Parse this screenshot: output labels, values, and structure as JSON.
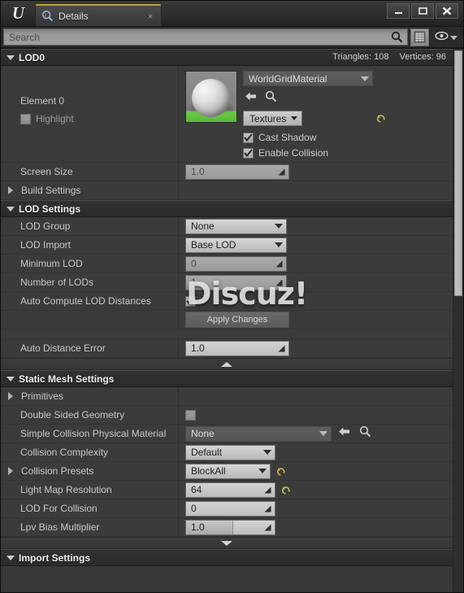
{
  "window": {
    "app_icon": "unreal-logo-icon",
    "controls": {
      "minimize": "minimize-icon",
      "maximize": "maximize-icon",
      "close": "close-icon"
    }
  },
  "tab": {
    "title": "Details",
    "icon": "details-magnifier-icon",
    "close": "×"
  },
  "search": {
    "placeholder": "Search",
    "value": "",
    "search_icon": "search-icon",
    "grid_icon": "grid-view-icon",
    "eye_icon": "eye-icon"
  },
  "watermark": "Discuz!",
  "categories": {
    "lod0": {
      "title": "LOD0",
      "triangles_label": "Triangles: 108",
      "vertices_label": "Vertices: 96"
    },
    "lod_settings": {
      "title": "LOD Settings"
    },
    "static_mesh_settings": {
      "title": "Static Mesh Settings"
    },
    "import_settings": {
      "title": "Import Settings"
    }
  },
  "lod0": {
    "element_label": "Element 0",
    "highlight_label": "Highlight",
    "material_name": "WorldGridMaterial",
    "textures_button": "Textures",
    "cast_shadow": {
      "label": "Cast Shadow",
      "checked": true
    },
    "enable_collision": {
      "label": "Enable Collision",
      "checked": true
    },
    "screen_size": {
      "label": "Screen Size",
      "value": "1.0"
    },
    "build_settings": {
      "label": "Build Settings"
    }
  },
  "lod_settings": {
    "lod_group": {
      "label": "LOD Group",
      "value": "None"
    },
    "lod_import": {
      "label": "LOD Import",
      "value": "Base LOD"
    },
    "minimum_lod": {
      "label": "Minimum LOD",
      "value": "0"
    },
    "number_of_lods": {
      "label": "Number of LODs",
      "value": "1"
    },
    "auto_compute": {
      "label": "Auto Compute LOD Distances",
      "checked": true
    },
    "apply_changes": {
      "label": "Apply Changes"
    },
    "auto_distance_error": {
      "label": "Auto Distance Error",
      "value": "1.0"
    }
  },
  "static_mesh_settings": {
    "primitives": {
      "label": "Primitives"
    },
    "double_sided": {
      "label": "Double Sided Geometry",
      "checked": false
    },
    "simple_collision_material": {
      "label": "Simple Collision Physical Material",
      "value": "None"
    },
    "collision_complexity": {
      "label": "Collision Complexity",
      "value": "Default"
    },
    "collision_presets": {
      "label": "Collision Presets",
      "value": "BlockAll"
    },
    "light_map_resolution": {
      "label": "Light Map Resolution",
      "value": "64"
    },
    "lod_for_collision": {
      "label": "LOD For Collision",
      "value": "0"
    },
    "lpv_bias_multiplier": {
      "label": "Lpv Bias Multiplier",
      "value": "1.0"
    }
  },
  "colors": {
    "panel_bg": "#383838",
    "row_bg": "#3b3b3b",
    "header_bg": "#2e2e2e",
    "tab_accent": "#b6a436",
    "revert_yellow": "#c9c451",
    "text": "#c8c8c8"
  }
}
